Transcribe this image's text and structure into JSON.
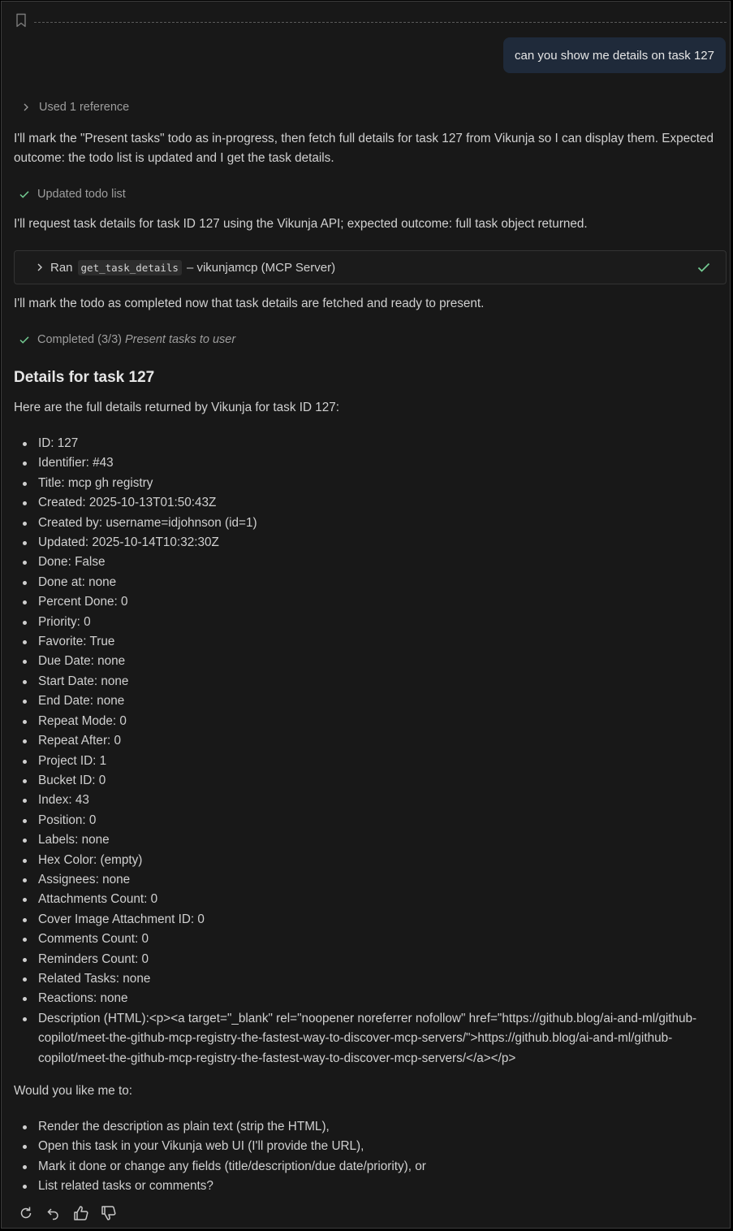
{
  "user_message": "can you show me details on task 127",
  "reference_label": "Used 1 reference",
  "intro_text": "I'll mark the \"Present tasks\" todo as in-progress, then fetch full details for task 127 from Vikunja so I can display them. Expected outcome: the todo list is updated and I get the task details.",
  "updated_todo_label": "Updated todo list",
  "request_text": "I'll request task details for task ID 127 using the Vikunja API; expected outcome: full task object returned.",
  "tool_call": {
    "prefix": "Ran",
    "tool_name": "get_task_details",
    "suffix": "– vikunjamcp (MCP Server)"
  },
  "completion_text": "I'll mark the todo as completed now that task details are fetched and ready to present.",
  "completed_status": {
    "label": "Completed (3/3)",
    "task": "Present tasks to user"
  },
  "heading": "Details for task 127",
  "lead_text": "Here are the full details returned by Vikunja for task ID 127:",
  "details": [
    "ID: 127",
    "Identifier: #43",
    "Title: mcp gh registry",
    "Created: 2025-10-13T01:50:43Z",
    "Created by: username=idjohnson (id=1)",
    "Updated: 2025-10-14T10:32:30Z",
    "Done: False",
    "Done at: none",
    "Percent Done: 0",
    "Priority: 0",
    "Favorite: True",
    "Due Date: none",
    "Start Date: none",
    "End Date: none",
    "Repeat Mode: 0",
    "Repeat After: 0",
    "Project ID: 1",
    "Bucket ID: 0",
    "Index: 43",
    "Position: 0",
    "Labels: none",
    "Hex Color: (empty)",
    "Assignees: none",
    "Attachments Count: 0",
    "Cover Image Attachment ID: 0",
    "Comments Count: 0",
    "Reminders Count: 0",
    "Related Tasks: none",
    "Reactions: none",
    "Description (HTML):<p><a target=\"_blank\" rel=\"noopener noreferrer nofollow\" href=\"https://github.blog/ai-and-ml/github-copilot/meet-the-github-mcp-registry-the-fastest-way-to-discover-mcp-servers/\">https://github.blog/ai-and-ml/github-copilot/meet-the-github-mcp-registry-the-fastest-way-to-discover-mcp-servers/</a></p>"
  ],
  "followup_question": "Would you like me to:",
  "options": [
    "Render the description as plain text (strip the HTML),",
    "Open this task in your Vikunja web UI (I'll provide the URL),",
    "Mark it done or change any fields (title/description/due date/priority), or",
    "List related tasks or comments?"
  ],
  "icons": {
    "bookmark": "bookmark-icon",
    "chevron": "chevron-right-icon",
    "check": "check-icon",
    "retry": "retry-icon",
    "undo": "undo-icon",
    "thumbs_up": "thumbs-up-icon",
    "thumbs_down": "thumbs-down-icon"
  },
  "colors": {
    "background": "#181818",
    "user_bubble": "#1f2a3a",
    "check_green": "#73c991",
    "muted_text": "#9d9d9d"
  }
}
